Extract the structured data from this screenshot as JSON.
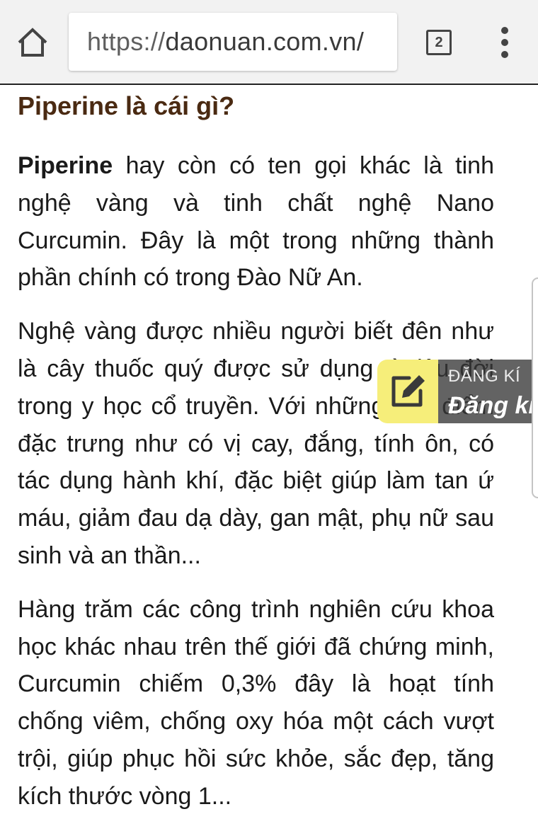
{
  "browser": {
    "home_icon": "home-icon",
    "url_scheme": "https://",
    "url_host": "daonuan.com.vn/",
    "tab_count": "2",
    "menu_icon": "more-vert-icon"
  },
  "article": {
    "heading": "Piperine là cái gì?",
    "p1_lead": "Piperine",
    "p1_text": " hay còn có ten gọi khác là tinh nghệ vàng và tinh chất nghệ Nano Curcumin. Đây là một trong những thành phần chính có trong Đào Nữ An.",
    "p2_text": "Nghệ vàng được nhiều người biết đên như là cây thuốc quý được sử dụng từ lâu đời trong y học cổ truyền. Với những đặc điểm đặc trưng như có vị cay, đắng, tính ôn, có tác dụng hành khí, đặc biệt giúp làm tan ứ máu, giảm đau dạ dày, gan mật, phụ nữ sau sinh và an thần...",
    "p3_text": "Hàng trăm các công trình nghiên cứu khoa học khác nhau trên thế giới đã chứng minh, Curcumin chiếm 0,3% đây là hoạt tính chống viêm, chống oxy hóa một cách vượt trội, giúp phục hồi sức khỏe, sắc đẹp, tăng kích thước vòng 1..."
  },
  "register_widget": {
    "icon": "edit-icon",
    "small_label": "ĐĂNG KÍ",
    "big_label": "Đăng kí",
    "accent_color": "#f6ee7a"
  }
}
